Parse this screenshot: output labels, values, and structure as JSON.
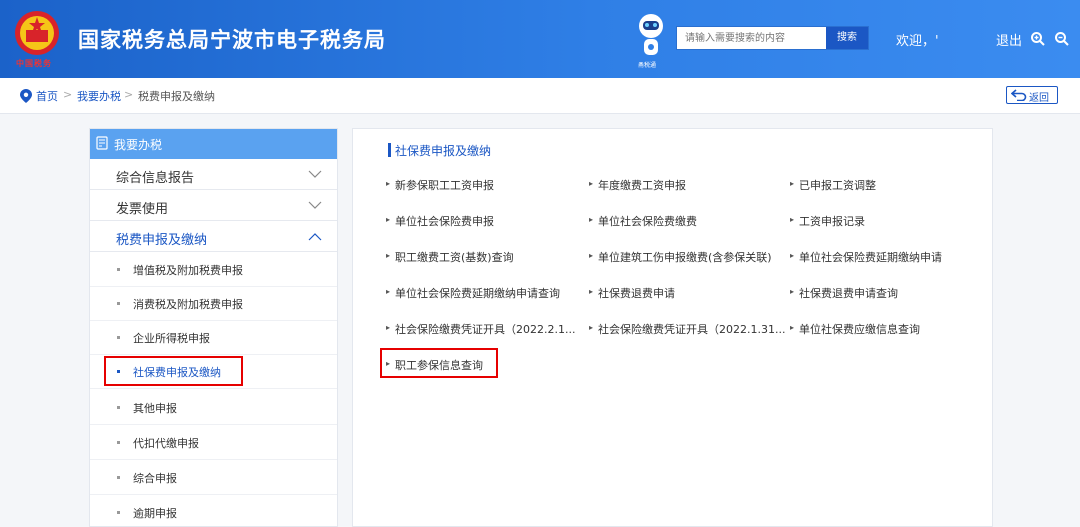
{
  "header": {
    "emblem_text": "中国税务",
    "title": "国家税务总局宁波市电子税务局",
    "robot_label": "甬税通",
    "search_placeholder": "请输入需要搜索的内容",
    "search_button": "搜索",
    "welcome": "欢迎，'",
    "logout": "退出"
  },
  "breadcrumb": {
    "home": "首页",
    "separator": ">",
    "section": "我要办税",
    "current": "税费申报及缴纳",
    "back": "返回"
  },
  "sidebar": {
    "header": "我要办税",
    "items": [
      {
        "label": "综合信息报告",
        "state": "collapsed"
      },
      {
        "label": "发票使用",
        "state": "collapsed"
      },
      {
        "label": "税费申报及缴纳",
        "state": "expanded"
      }
    ],
    "sub_items": [
      {
        "label": "增值税及附加税费申报"
      },
      {
        "label": "消费税及附加税费申报"
      },
      {
        "label": "企业所得税申报"
      },
      {
        "label": "社保费申报及缴纳"
      },
      {
        "label": "其他申报"
      },
      {
        "label": "代扣代缴申报"
      },
      {
        "label": "综合申报"
      },
      {
        "label": "逾期申报"
      }
    ],
    "active_sub": "社保费申报及缴纳"
  },
  "content": {
    "section_title": "社保费申报及缴纳",
    "links": [
      [
        "新参保职工工资申报",
        "年度缴费工资申报",
        "已申报工资调整"
      ],
      [
        "单位社会保险费申报",
        "单位社会保险费缴费",
        "工资申报记录"
      ],
      [
        "职工缴费工资(基数)查询",
        "单位建筑工伤申报缴费(含参保关联)",
        "单位社会保险费延期缴纳申请"
      ],
      [
        "单位社会保险费延期缴纳申请查询",
        "社保费退费申请",
        "社保费退费申请查询"
      ],
      [
        "社会保险缴费凭证开具（2022.2.1...",
        "社会保险缴费凭证开具（2022.1.31...",
        "单位社保费应缴信息查询"
      ],
      [
        "职工参保信息查询"
      ]
    ]
  },
  "colors": {
    "header_blue": "#2f7fe6",
    "accent": "#1b57c4",
    "sidebar_header": "#5aa2f0",
    "highlight_red": "#e60000"
  }
}
